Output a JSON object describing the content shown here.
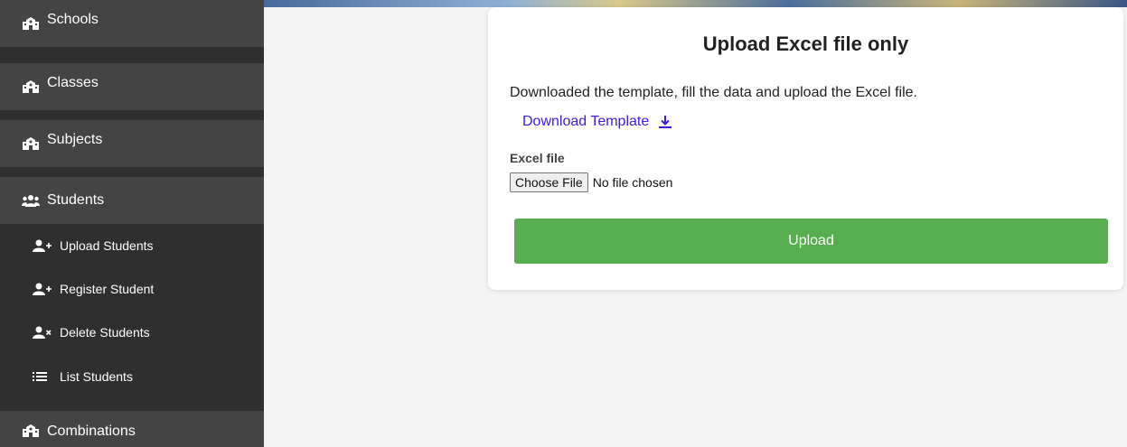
{
  "sidebar": {
    "items": [
      {
        "label": "Schools",
        "icon": "school-icon"
      },
      {
        "label": "Classes",
        "icon": "school-icon"
      },
      {
        "label": "Subjects",
        "icon": "school-icon"
      },
      {
        "label": "Students",
        "icon": "users-icon"
      },
      {
        "label": "Combinations",
        "icon": "school-icon"
      }
    ],
    "students_submenu": [
      {
        "label": "Upload Students",
        "icon": "user-plus-icon"
      },
      {
        "label": "Register Student",
        "icon": "user-plus-icon"
      },
      {
        "label": "Delete Students",
        "icon": "user-times-icon"
      },
      {
        "label": "List Students",
        "icon": "list-icon"
      }
    ]
  },
  "upload_card": {
    "title": "Upload Excel file only",
    "instructions": "Downloaded the template, fill the data and upload the Excel file.",
    "template_link": "Download Template",
    "file_label": "Excel file",
    "choose_file_button": "Choose File",
    "file_status": "No file chosen",
    "upload_button": "Upload"
  },
  "colors": {
    "sidebar_bg": "#2f2f2f",
    "sidebar_item_bg": "#444444",
    "link": "#3b1ee0",
    "upload_button": "#57ae4f"
  }
}
